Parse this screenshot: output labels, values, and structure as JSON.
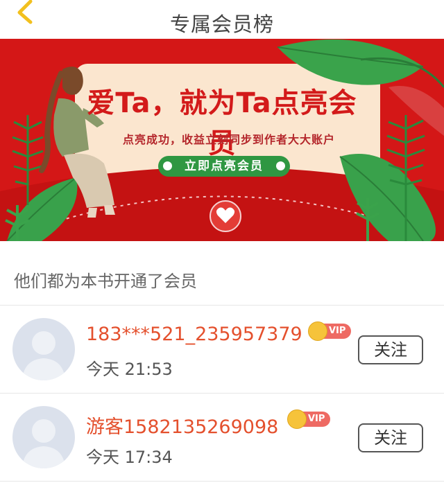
{
  "header": {
    "title": "专属会员榜"
  },
  "banner": {
    "headline": "爱Ta，就为Ta点亮会员",
    "subline": "点亮成功，收益立刻同步到作者大大账户",
    "cta_label": "立即点亮会员"
  },
  "section": {
    "label": "他们都为本书开通了会员"
  },
  "members": [
    {
      "name": "183***521_235957379",
      "badge": "VIP",
      "time": "今天 21:53",
      "follow_label": "关注"
    },
    {
      "name": "游客1582135269098",
      "badge": "VIP",
      "time": "今天 17:34",
      "follow_label": "关注"
    }
  ],
  "colors": {
    "banner_red": "#d41717",
    "username": "#e4502d",
    "cta_green": "#2f9742",
    "vip_pill": "#ee6a63",
    "vip_crown": "#f6c33a"
  },
  "icons": {
    "back": "chevron-left-icon",
    "avatar": "default-user-avatar-icon",
    "vip": "crown-icon"
  }
}
